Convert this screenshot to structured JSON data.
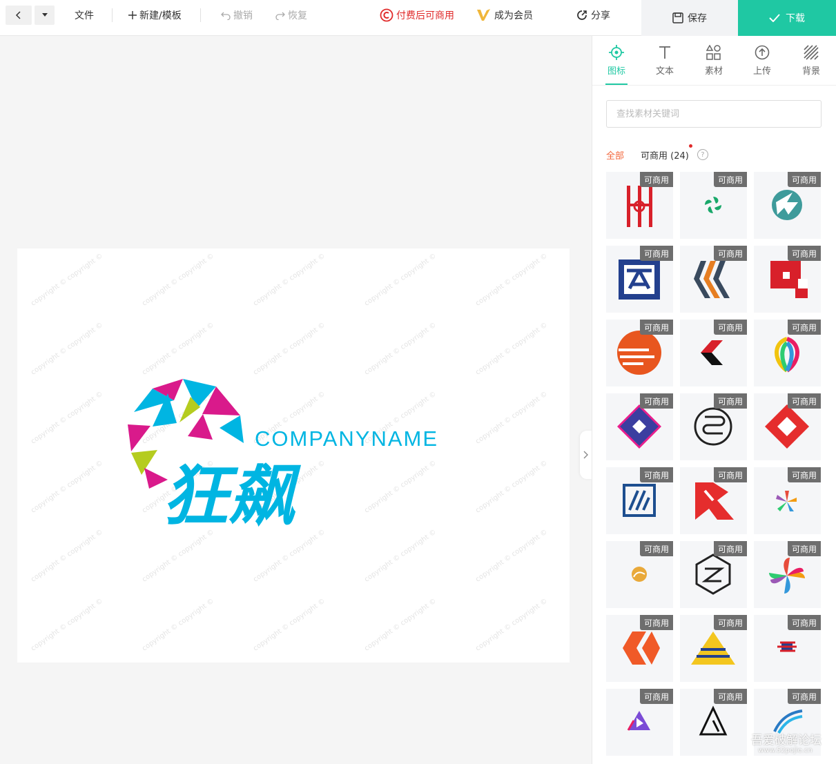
{
  "toolbar": {
    "file": "文件",
    "new_template": "新建/模板",
    "undo": "撤销",
    "redo": "恢复",
    "paid_commercial": "付费后可商用",
    "become_member": "成为会员",
    "share": "分享",
    "save": "保存",
    "download": "下载"
  },
  "canvas": {
    "company_name": "COMPANYNAME",
    "brand_name": "狂飙",
    "watermark_text": "copyright © copyright ©"
  },
  "panel": {
    "tabs": [
      {
        "label": "图标",
        "icon": "target-icon",
        "active": true
      },
      {
        "label": "文本",
        "icon": "text-icon",
        "active": false
      },
      {
        "label": "素材",
        "icon": "shapes-icon",
        "active": false
      },
      {
        "label": "上传",
        "icon": "upload-icon",
        "active": false
      },
      {
        "label": "背景",
        "icon": "background-icon",
        "active": false
      }
    ],
    "search_placeholder": "查找素材关键词",
    "filter_all": "全部",
    "filter_commercial": "可商用 (24)",
    "help": "?",
    "tag_label": "可商用",
    "items": [
      "logo-red-bars",
      "logo-green-swirl",
      "logo-teal-circle",
      "logo-blue-square",
      "logo-chevrons",
      "logo-red-blocks",
      "logo-orange-sun",
      "logo-red-arrow",
      "logo-colorful-petals",
      "logo-purple-diamond",
      "logo-circle-s",
      "logo-red-diamond",
      "logo-blue-stripes",
      "logo-red-m",
      "logo-star-colors",
      "logo-small-gold",
      "logo-hexagon-z",
      "logo-colorful-flower",
      "logo-orange-x",
      "logo-yellow-pyramid",
      "logo-flag-stripes",
      "logo-play-triangle",
      "logo-black-a",
      "logo-blue-wave"
    ]
  },
  "watermark": {
    "title": "吾爱破解论坛",
    "url": "www.52pojie.cn"
  },
  "colors": {
    "accent": "#1fc8a3",
    "orange": "#f2673c",
    "red": "#e02a2a",
    "logo_cyan": "#00b5e2",
    "logo_magenta": "#d91a8b",
    "logo_lime": "#b5cc1f"
  }
}
